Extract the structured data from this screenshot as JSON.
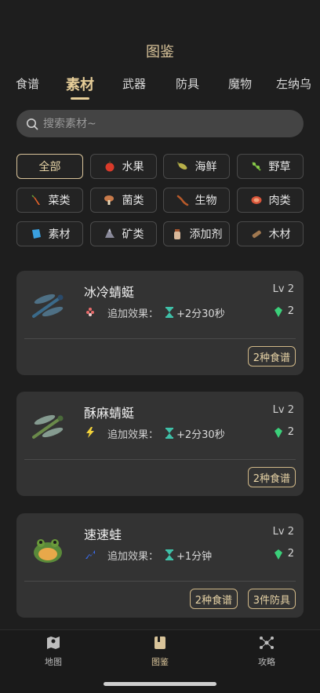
{
  "header": {
    "title": "图鉴"
  },
  "tabs": [
    {
      "label": "食谱"
    },
    {
      "label": "素材"
    },
    {
      "label": "武器"
    },
    {
      "label": "防具"
    },
    {
      "label": "魔物"
    },
    {
      "label": "左纳乌"
    }
  ],
  "active_tab": "素材",
  "search": {
    "placeholder": "搜索素材~",
    "value": ""
  },
  "filters": [
    {
      "label": "全部",
      "icon": "none"
    },
    {
      "label": "水果",
      "icon": "apple-icon"
    },
    {
      "label": "海鲜",
      "icon": "fish-icon"
    },
    {
      "label": "野草",
      "icon": "herb-icon"
    },
    {
      "label": "菜类",
      "icon": "carrot-icon"
    },
    {
      "label": "菌类",
      "icon": "mushroom-icon"
    },
    {
      "label": "生物",
      "icon": "lizard-icon"
    },
    {
      "label": "肉类",
      "icon": "meat-icon"
    },
    {
      "label": "素材",
      "icon": "material-icon"
    },
    {
      "label": "矿类",
      "icon": "ore-icon"
    },
    {
      "label": "添加剂",
      "icon": "jar-icon"
    },
    {
      "label": "木材",
      "icon": "wood-icon"
    }
  ],
  "active_filter": "全部",
  "cards": [
    {
      "name": "冰冷蜻蜓",
      "level": "Lv 2",
      "effect_label": "追加效果：",
      "effect_value": "+2分30秒",
      "gems": "2",
      "effect_icon": "cold-resist-icon",
      "badges": [
        "2种食谱"
      ]
    },
    {
      "name": "酥麻蜻蜓",
      "level": "Lv 2",
      "effect_label": "追加效果：",
      "effect_value": "+2分30秒",
      "gems": "2",
      "effect_icon": "lightning-icon",
      "badges": [
        "2种食谱"
      ]
    },
    {
      "name": "速速蛙",
      "level": "Lv 2",
      "effect_label": "追加效果：",
      "effect_value": "+1分钟",
      "gems": "2",
      "effect_icon": "speed-icon",
      "badges": [
        "2种食谱",
        "3件防具"
      ]
    }
  ],
  "bottom_nav": [
    {
      "label": "地图",
      "icon": "map-icon"
    },
    {
      "label": "图鉴",
      "icon": "book-icon"
    },
    {
      "label": "攻略",
      "icon": "network-icon"
    }
  ],
  "active_nav": "图鉴",
  "colors": {
    "background": "#1e1e1e",
    "card": "#333333",
    "accent_gold": "#d9c49a",
    "gem_green": "#3bd07a",
    "hourglass_teal": "#3fc0a8"
  }
}
